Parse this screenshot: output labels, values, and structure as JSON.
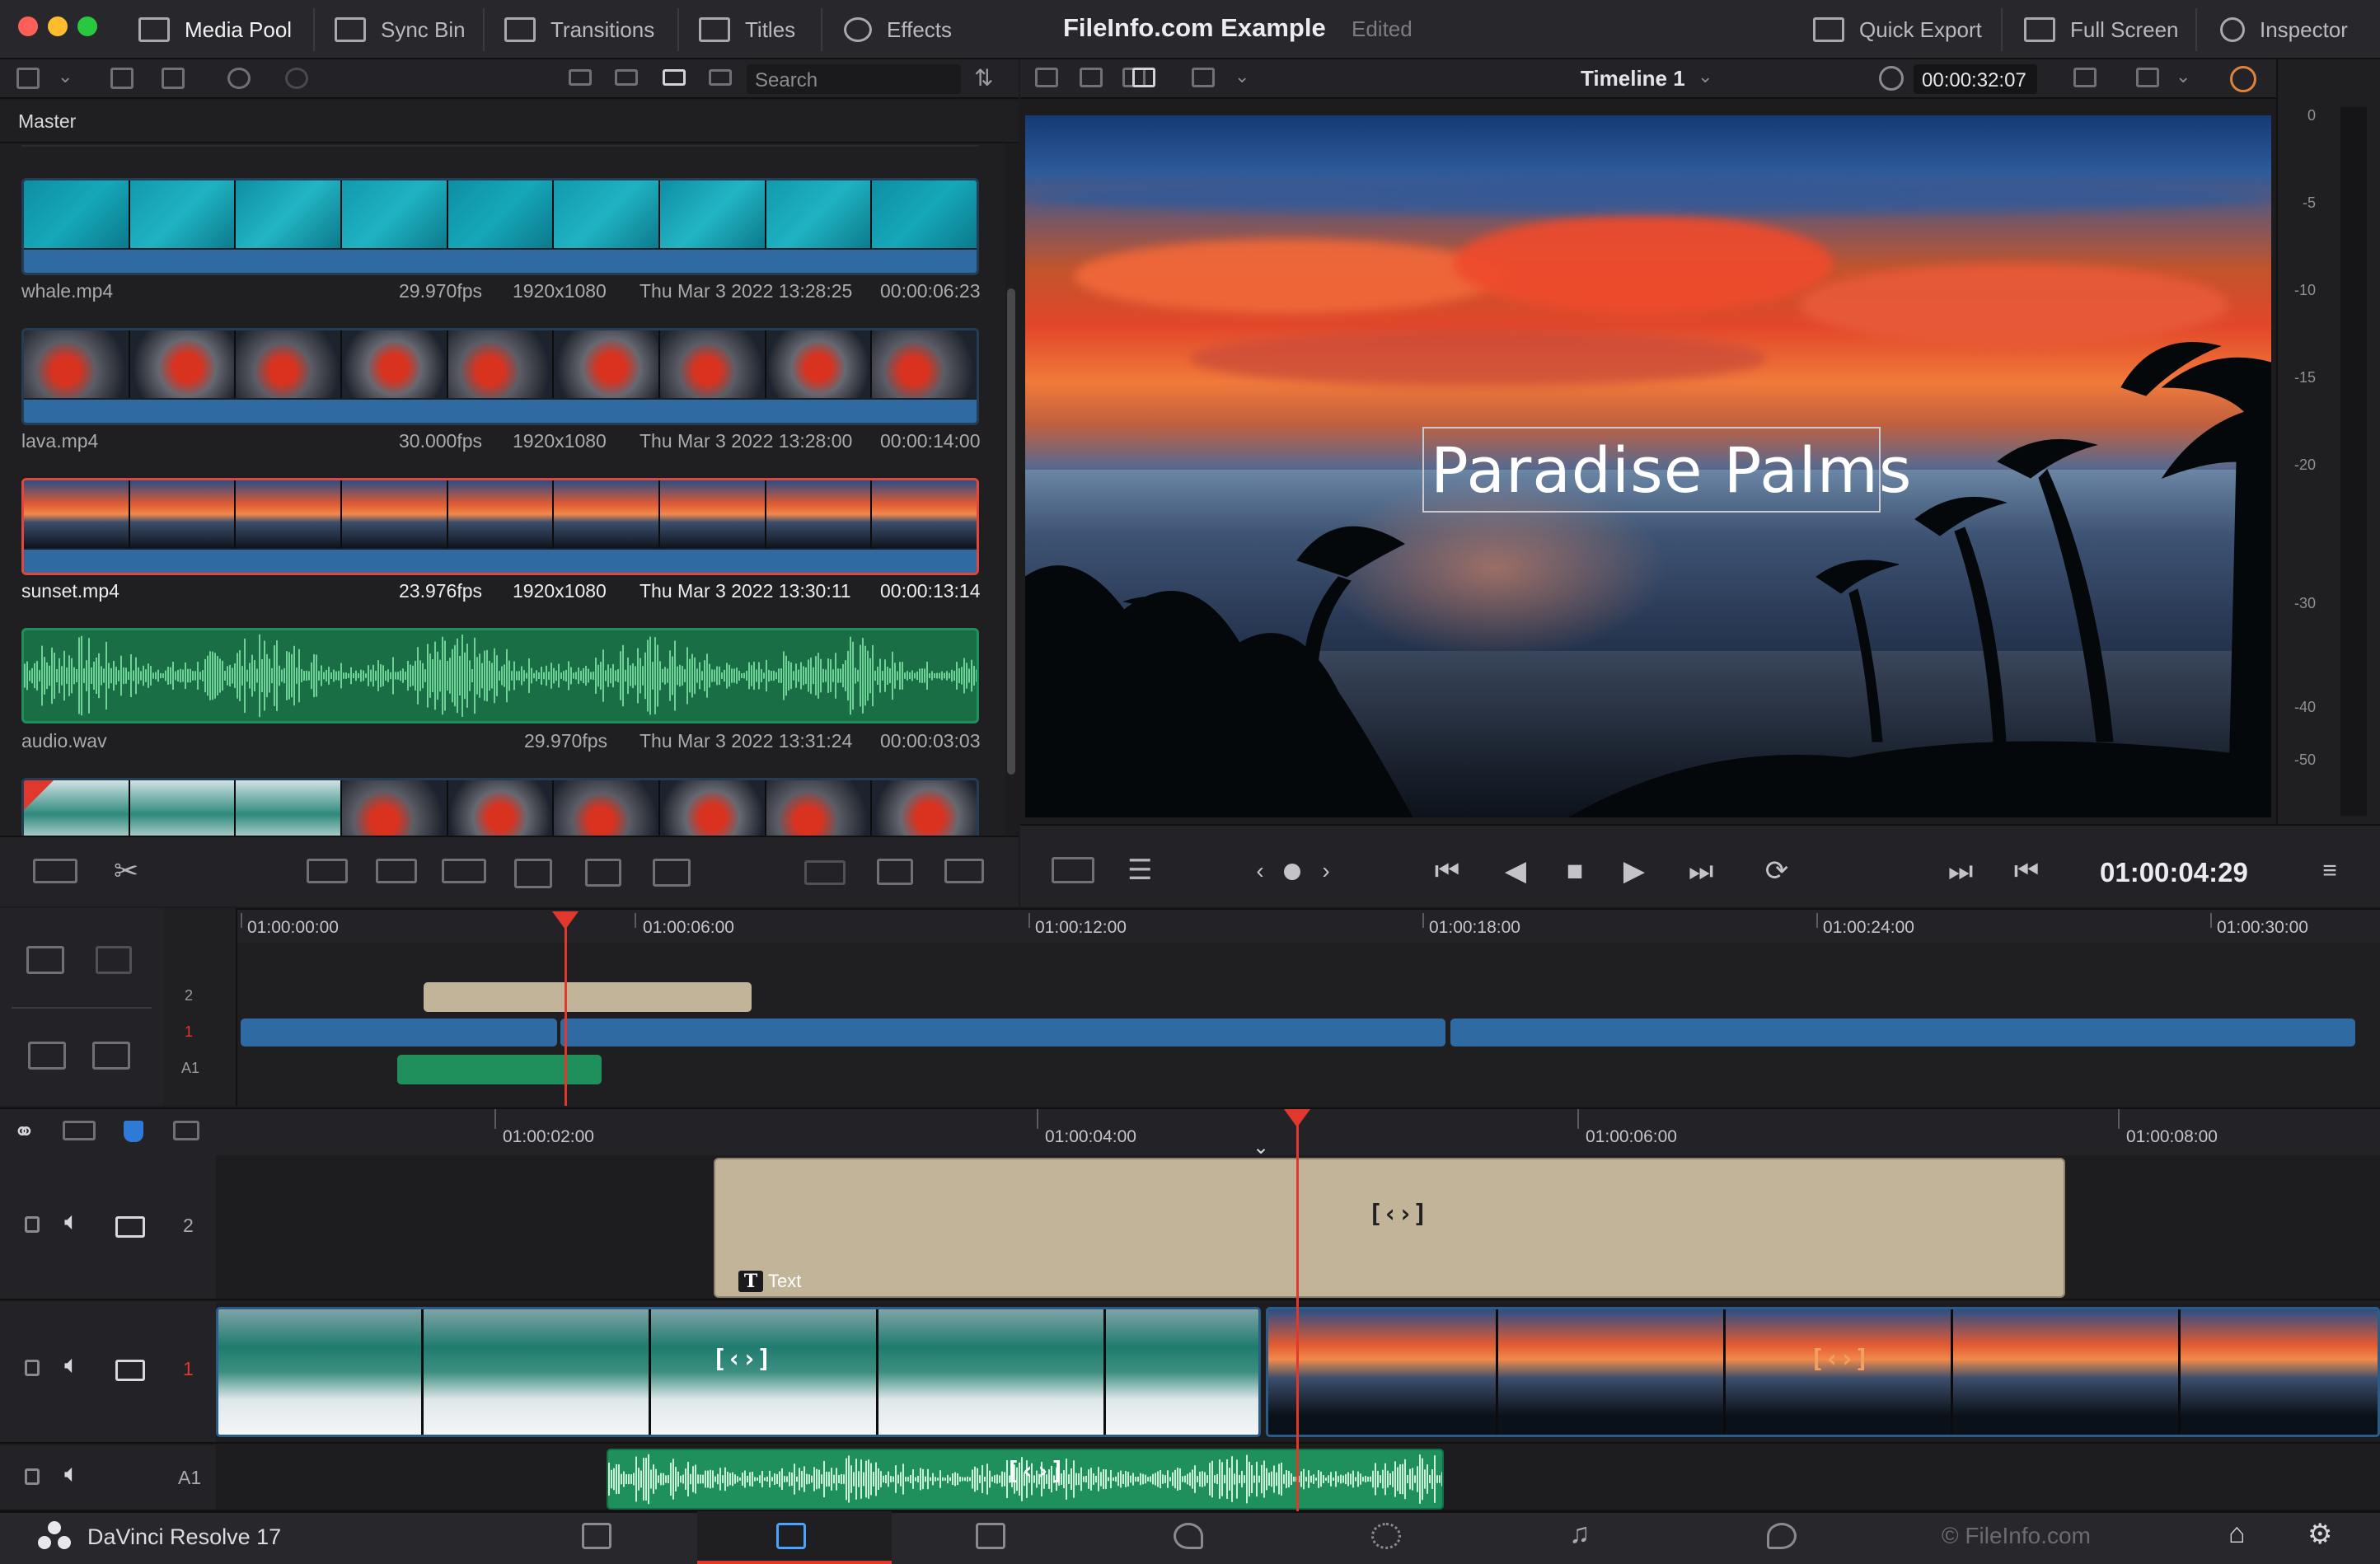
{
  "window": {
    "title": "FileInfo.com Example",
    "status": "Edited"
  },
  "topbar": {
    "left_tabs": [
      {
        "label": "Media Pool",
        "icon": "media-pool-icon"
      },
      {
        "label": "Sync Bin",
        "icon": "sync-bin-icon"
      },
      {
        "label": "Transitions",
        "icon": "transitions-icon"
      },
      {
        "label": "Titles",
        "icon": "titles-icon"
      },
      {
        "label": "Effects",
        "icon": "effects-icon"
      }
    ],
    "right_buttons": [
      {
        "label": "Quick Export",
        "icon": "export-icon"
      },
      {
        "label": "Full Screen",
        "icon": "full-screen-icon"
      },
      {
        "label": "Inspector",
        "icon": "inspector-icon"
      }
    ]
  },
  "media_pool": {
    "search_placeholder": "Search",
    "bin_name": "Master",
    "clips": [
      {
        "name": "whale.mp4",
        "fps": "29.970fps",
        "resolution": "1920x1080",
        "date": "Thu Mar 3 2022 13:28:25",
        "duration": "00:00:06:23",
        "kind": "video",
        "selected": false
      },
      {
        "name": "lava.mp4",
        "fps": "30.000fps",
        "resolution": "1920x1080",
        "date": "Thu Mar 3 2022 13:28:00",
        "duration": "00:00:14:00",
        "kind": "video",
        "selected": false
      },
      {
        "name": "sunset.mp4",
        "fps": "23.976fps",
        "resolution": "1920x1080",
        "date": "Thu Mar 3 2022 13:30:11",
        "duration": "00:00:13:14",
        "kind": "video",
        "selected": true
      },
      {
        "name": "audio.wav",
        "fps": "29.970fps",
        "resolution": "",
        "date": "Thu Mar 3 2022 13:31:24",
        "duration": "00:00:03:03",
        "kind": "audio",
        "selected": false
      }
    ]
  },
  "viewer": {
    "timeline_name": "Timeline 1",
    "source_timecode": "00:00:32:07",
    "title_overlay": "Paradise Palms",
    "current_timecode": "01:00:04:29"
  },
  "audio_meter": {
    "ticks": [
      "0",
      "-5",
      "-10",
      "-15",
      "-20",
      "-30",
      "-40",
      "-50"
    ]
  },
  "upper_timeline": {
    "ruler": [
      "01:00:00:00",
      "01:00:06:00",
      "01:00:12:00",
      "01:00:18:00",
      "01:00:24:00",
      "01:00:30:00"
    ],
    "tracks": [
      "2",
      "1",
      "A1"
    ]
  },
  "lower_timeline": {
    "ruler": [
      "01:00:02:00",
      "01:00:04:00",
      "01:00:06:00",
      "01:00:08:00"
    ],
    "tracks": [
      {
        "number": "2"
      },
      {
        "number": "1"
      },
      {
        "number": "A1"
      }
    ],
    "text_clip_label": "Text"
  },
  "bottombar": {
    "product": "DaVinci Resolve 17",
    "watermark": "© FileInfo.com",
    "pages": [
      "media-page-icon",
      "cut-page-icon",
      "edit-page-icon",
      "fusion-page-icon",
      "color-page-icon",
      "fairlight-page-icon",
      "deliver-page-icon"
    ]
  },
  "colors": {
    "accent_blue": "#2f6aa3",
    "playhead_red": "#e0382d",
    "text_clip": "#c2b498",
    "audio_green": "#1f8f5c",
    "selected_border": "#e2463c"
  }
}
